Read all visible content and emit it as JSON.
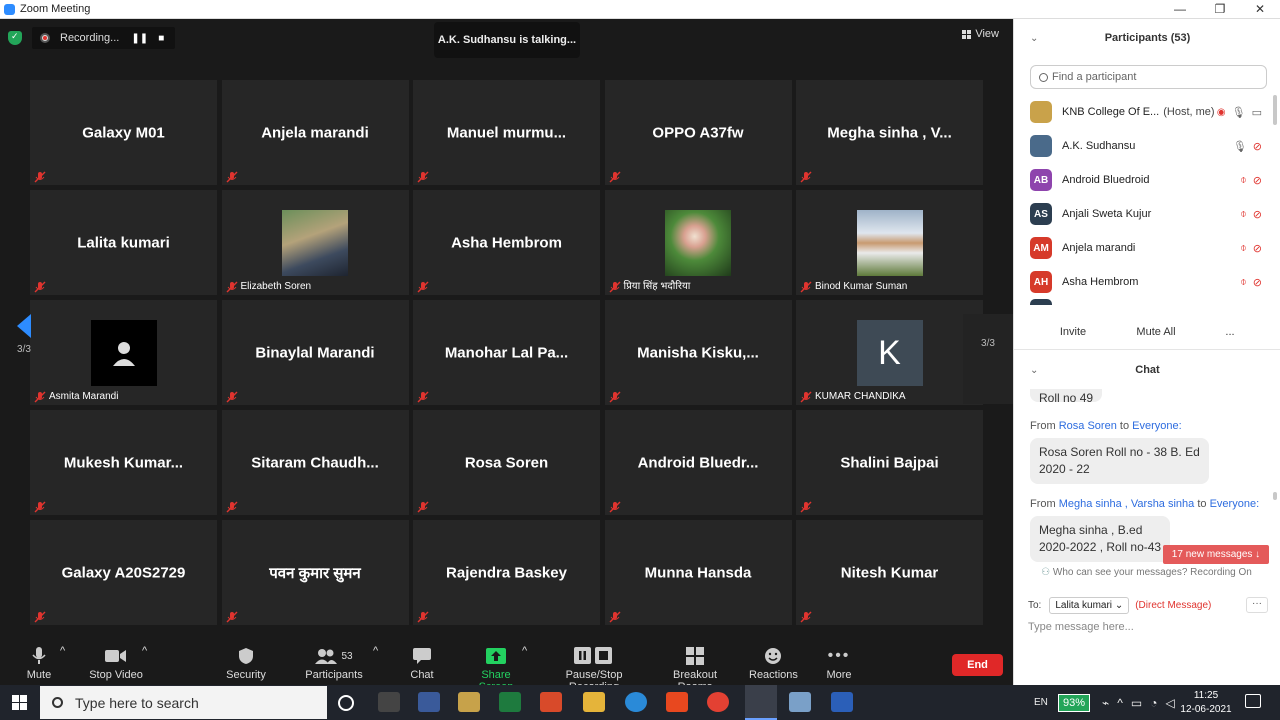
{
  "window": {
    "title": "Zoom Meeting",
    "controls": [
      "—",
      "❐",
      "✕"
    ]
  },
  "top": {
    "recording_label": "Recording...",
    "talking": "A.K. Sudhansu is talking...",
    "view_label": "View"
  },
  "tiles": [
    {
      "name": "Galaxy M01"
    },
    {
      "name": "Anjela marandi"
    },
    {
      "name": "Manuel  murmu..."
    },
    {
      "name": "OPPO A37fw"
    },
    {
      "name": "Megha sinha , V..."
    },
    {
      "name": "Lalita kumari"
    },
    {
      "label": "Elizabeth Soren"
    },
    {
      "name": "Asha Hembrom"
    },
    {
      "label": "प्रिया सिंह भदौरिया"
    },
    {
      "label": "Binod Kumar Suman"
    },
    {
      "label": "Asmita Marandi"
    },
    {
      "name": "Binaylal Marandi"
    },
    {
      "name": "Manohar  Lal Pa..."
    },
    {
      "name": "Manisha  Kisku,..."
    },
    {
      "label": "KUMAR CHANDIKA",
      "initial": "K"
    },
    {
      "name": "Mukesh  Kumar..."
    },
    {
      "name": "Sitaram  Chaudh..."
    },
    {
      "name": "Rosa Soren"
    },
    {
      "name": "Android  Bluedr..."
    },
    {
      "name": "Shalini Bajpai"
    },
    {
      "name": "Galaxy A20S2729"
    },
    {
      "name": "पवन कुमार सुमन"
    },
    {
      "name": "Rajendra Baskey"
    },
    {
      "name": "Munna Hansda"
    },
    {
      "name": "Nitesh Kumar"
    }
  ],
  "pager": {
    "left": "3/3",
    "right": "3/3"
  },
  "toolbar": {
    "mute": "Mute",
    "stop_video": "Stop Video",
    "security": "Security",
    "participants": "Participants",
    "participants_count": "53",
    "chat": "Chat",
    "share_screen": "Share Screen",
    "pause_stop_recording": "Pause/Stop Recording",
    "breakout_rooms": "Breakout Rooms",
    "reactions": "Reactions",
    "more": "More",
    "end": "End"
  },
  "participants_panel": {
    "title": "Participants (53)",
    "search_placeholder": "Find a participant",
    "list": [
      {
        "name": "KNB College Of E...",
        "role": "(Host, me)",
        "initials": "",
        "color": "#c9a24a"
      },
      {
        "name": "A.K. Sudhansu",
        "initials": "",
        "color": "#4a6a8a"
      },
      {
        "name": "Android Bluedroid",
        "initials": "AB",
        "color": "#8e44ad"
      },
      {
        "name": "Anjali Sweta Kujur",
        "initials": "AS",
        "color": "#2c3e50"
      },
      {
        "name": "Anjela marandi",
        "initials": "AM",
        "color": "#d63a2a"
      },
      {
        "name": "Asha Hembrom",
        "initials": "AH",
        "color": "#d63a2a"
      }
    ],
    "invite": "Invite",
    "mute_all": "Mute All",
    "more": "..."
  },
  "chat_panel": {
    "title": "Chat",
    "partial_line": "Roll no 49",
    "messages": [
      {
        "from": "Rosa Soren",
        "to": "Everyone:",
        "text_lines": [
          "Rosa Soren Roll no - 38 B. Ed",
          "2020 - 22"
        ]
      },
      {
        "from": "Megha sinha , Varsha sinha",
        "to": "Everyone:",
        "text_lines": [
          "Megha sinha  , B.ed",
          "2020-2022 , Roll no-43"
        ]
      }
    ],
    "from_word": "From",
    "to_word": "to",
    "new_messages": "17 new messages ↓",
    "who_can_see": "Who can see your messages? Recording On",
    "to_label": "To:",
    "recipient": "Lalita kumari",
    "direct": "(Direct Message)",
    "input_placeholder": "Type message here..."
  },
  "taskbar": {
    "search_placeholder": "Type here to search",
    "lang": "EN",
    "battery": "93%",
    "time": "11:25",
    "date": "12-06-2021"
  }
}
